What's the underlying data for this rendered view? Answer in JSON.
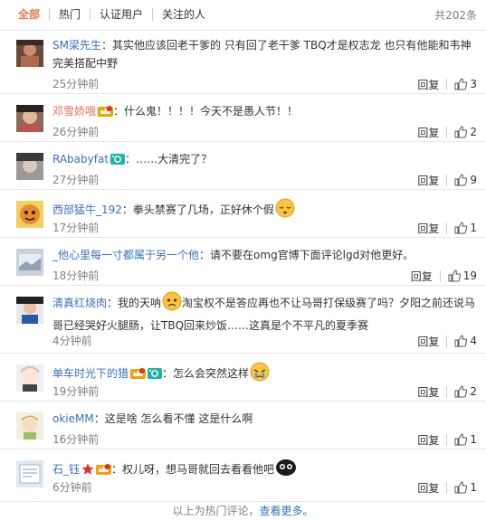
{
  "tabs": [
    "全部",
    "热门",
    "认证用户",
    "关注的人"
  ],
  "total": "共202条",
  "reply_label": "回复",
  "comments": [
    {
      "user": "SM梁先生",
      "name_color": "blue",
      "sep": "：",
      "text": "其实他应该回老干爹的 只有回了老干爹 TBQ才是权志龙 也只有他能和韦神完美搭配中野",
      "time": "25分钟前",
      "likes": "3",
      "badges": [],
      "emoji": "",
      "avatar_icon": "avatar-icon"
    },
    {
      "user": "邓雪娇哦",
      "name_color": "orange",
      "sep": "：",
      "text": "什么鬼！！！！今天不是愚人节！！",
      "time": "26分钟前",
      "likes": "2",
      "badges": [
        "member-crown-icon"
      ],
      "emoji": "",
      "avatar_icon": "avatar-icon"
    },
    {
      "user": "RAbabyfat",
      "name_color": "blue",
      "sep": "：",
      "text": "……大清完了？",
      "time": "27分钟前",
      "likes": "9",
      "badges": [
        "camera-badge-icon"
      ],
      "emoji": "",
      "avatar_icon": "avatar-icon"
    },
    {
      "user": "西部猛牛_192",
      "name_color": "blue",
      "sep": "：",
      "text": "拳头禁赛了几场，正好休个假",
      "time": "17分钟前",
      "likes": "1",
      "badges": [],
      "emoji": "sleepy-face-icon",
      "avatar_icon": "avatar-icon"
    },
    {
      "user": "_他心里每一寸都属于另一个他",
      "name_color": "blue",
      "sep": "：",
      "text": "请不要在omg官博下面评论lgd对他更好。",
      "time": "18分钟前",
      "likes": "19",
      "badges": [],
      "emoji": "",
      "avatar_icon": "avatar-icon"
    },
    {
      "user": "清真红烧肉",
      "name_color": "blue",
      "sep": "：",
      "text_a": "我的天呐",
      "text_b": "淘宝权不是答应再也不让马哥打保级赛了吗？夕阳之前还说马哥已经哭好火腿肠，让TBQ回来炒饭……这真是个不平凡的夏季赛",
      "time": "4分钟前",
      "likes": "4",
      "badges": [],
      "emoji": "worried-face-icon",
      "avatar_icon": "avatar-icon"
    },
    {
      "user": "单车时光下的猎",
      "name_color": "blue",
      "sep": "：",
      "text": "怎么会突然这样",
      "time": "19分钟前",
      "likes": "2",
      "badges": [
        "member-crown-icon",
        "camera-badge-icon"
      ],
      "emoji": "crying-face-icon",
      "avatar_icon": "avatar-icon"
    },
    {
      "user": "okieMM",
      "name_color": "blue",
      "sep": "：",
      "text": "这是啥 怎么看不懂 这是什么啊",
      "time": "16分钟前",
      "likes": "1",
      "badges": [],
      "emoji": "",
      "avatar_icon": "avatar-icon"
    },
    {
      "user": "石_钰",
      "name_color": "blue",
      "sep": "：",
      "text": "权儿呀，想马哥就回去看看他吧",
      "time": "6分钟前",
      "likes": "1",
      "badges": [
        "red-star-icon",
        "member-crown-icon"
      ],
      "emoji": "black-blob-face-icon",
      "avatar_icon": "avatar-icon"
    }
  ],
  "footer": {
    "text": "以上为热门评论，",
    "link": "查看更多。"
  }
}
